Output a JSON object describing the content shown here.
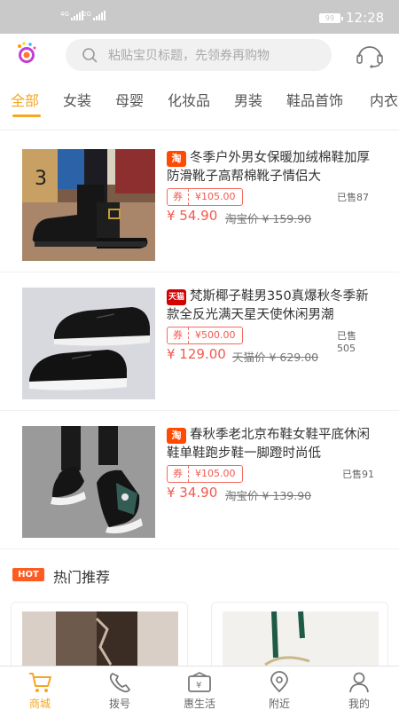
{
  "status_bar": {
    "signal1_tag": "4G",
    "signal2_tag": "2G",
    "battery": "99",
    "time": "12:28"
  },
  "header": {
    "search_placeholder": "粘贴宝贝标题，先领券再购物",
    "logo_icon": "app-logo-icon",
    "service_icon": "headset-icon"
  },
  "tabs": [
    {
      "label": "全部",
      "active": true
    },
    {
      "label": "女装",
      "active": false
    },
    {
      "label": "母婴",
      "active": false
    },
    {
      "label": "化妆品",
      "active": false
    },
    {
      "label": "男装",
      "active": false
    },
    {
      "label": "鞋品首饰",
      "active": false
    },
    {
      "label": "内衣",
      "active": false
    }
  ],
  "products": [
    {
      "badge": "淘",
      "title": "冬季户外男女保暖加绒棉鞋加厚防滑靴子高帮棉靴子情侣大",
      "coupon_label": "券",
      "coupon_value": "¥105.00",
      "sold": "已售87",
      "price": "¥ 54.90",
      "original": "淘宝价 ¥ 159.90"
    },
    {
      "badge": "天猫",
      "title": "梵斯椰子鞋男350真爆秋冬季新款全反光满天星天使休闲男潮",
      "coupon_label": "券",
      "coupon_value": "¥500.00",
      "sold": "已售505",
      "price": "¥ 129.00",
      "original": "天猫价 ¥ 629.00"
    },
    {
      "badge": "淘",
      "title": "春秋季老北京布鞋女鞋平底休闲鞋单鞋跑步鞋一脚蹬时尚低",
      "coupon_label": "券",
      "coupon_value": "¥105.00",
      "sold": "已售91",
      "price": "¥ 34.90",
      "original": "淘宝价 ¥ 139.90"
    }
  ],
  "hot": {
    "badge": "HOT",
    "title": "热门推荐"
  },
  "bottom_nav": [
    {
      "label": "商城",
      "icon": "cart-icon",
      "active": true
    },
    {
      "label": "拨号",
      "icon": "phone-icon",
      "active": false
    },
    {
      "label": "惠生活",
      "icon": "wallet-icon",
      "active": false
    },
    {
      "label": "附近",
      "icon": "location-icon",
      "active": false
    },
    {
      "label": "我的",
      "icon": "user-icon",
      "active": false
    }
  ],
  "colors": {
    "accent": "#f5a623",
    "price": "#f25a4f",
    "taobao_badge": "#ff4a00",
    "tmall_badge": "#d40000"
  }
}
